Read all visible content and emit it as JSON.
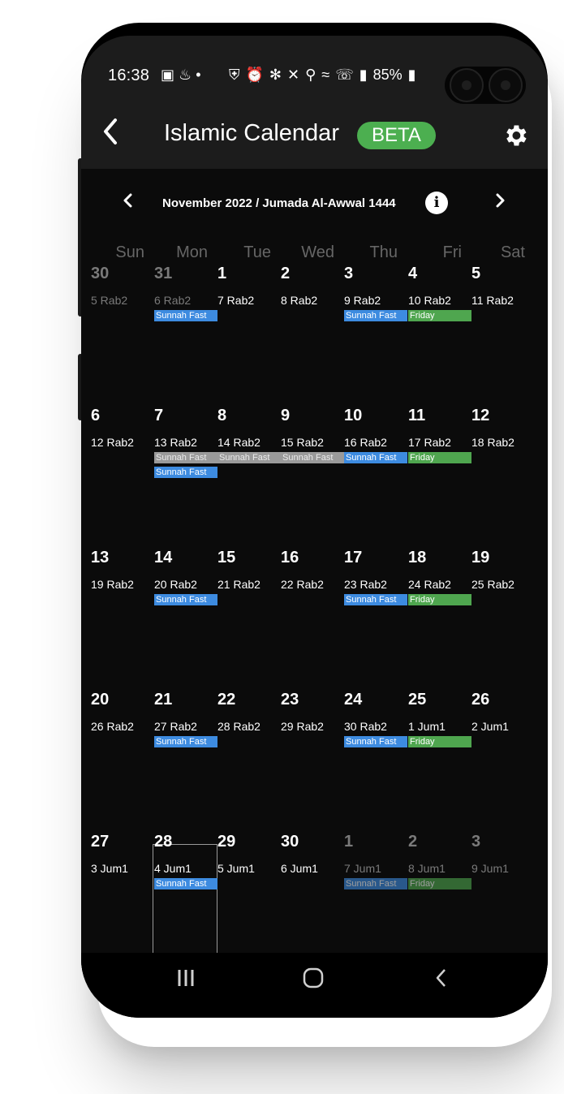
{
  "status_bar": {
    "time": "16:38",
    "battery": "85%",
    "icons": [
      "image-icon",
      "figure-icon",
      "dot-icon",
      "battery-saver-icon",
      "alarm-icon",
      "bluetooth-icon",
      "mute-icon",
      "location-icon",
      "wifi-icon",
      "wifi-call-icon",
      "signal-icon",
      "battery-icon"
    ]
  },
  "app_bar": {
    "back_icon": "chevron-left-icon",
    "title": "Islamic Calendar",
    "badge": "BETA",
    "settings_icon": "gear-icon",
    "badge_color": "#4caf50"
  },
  "month_nav": {
    "label": "November 2022 / Jumada Al-Awwal 1444",
    "prev_icon": "chevron-left-icon",
    "next_icon": "chevron-right-icon",
    "info_icon": "info-icon"
  },
  "weekdays": [
    "Sun",
    "Mon",
    "Tue",
    "Wed",
    "Thu",
    "Fri",
    "Sat"
  ],
  "colors": {
    "sunnah_fast": "#3d8be0",
    "friday": "#4fa64f",
    "background": "#0b0b0b"
  },
  "weeks": [
    [
      {
        "day": "30",
        "hijri": "5 Rab2",
        "dim": true
      },
      {
        "day": "31",
        "hijri": "6 Rab2",
        "dim": true,
        "events": [
          {
            "label": "Sunnah Fast",
            "type": "fast"
          }
        ]
      },
      {
        "day": "1",
        "hijri": "7 Rab2"
      },
      {
        "day": "2",
        "hijri": "8 Rab2"
      },
      {
        "day": "3",
        "hijri": "9 Rab2",
        "events": [
          {
            "label": "Sunnah Fast",
            "type": "fast"
          }
        ]
      },
      {
        "day": "4",
        "hijri": "10 Rab2",
        "events": [
          {
            "label": "Friday",
            "type": "fri"
          }
        ]
      },
      {
        "day": "5",
        "hijri": "11 Rab2"
      }
    ],
    [
      {
        "day": "6",
        "hijri": "12 Rab2"
      },
      {
        "day": "7",
        "hijri": "13 Rab2",
        "events": [
          {
            "label": "Sunnah Fast",
            "type": "grey"
          },
          {
            "label": "Sunnah Fast",
            "type": "fast"
          }
        ]
      },
      {
        "day": "8",
        "hijri": "14 Rab2",
        "events": [
          {
            "label": "Sunnah Fast",
            "type": "grey"
          }
        ]
      },
      {
        "day": "9",
        "hijri": "15 Rab2",
        "events": [
          {
            "label": "Sunnah Fast",
            "type": "grey"
          }
        ]
      },
      {
        "day": "10",
        "hijri": "16 Rab2",
        "events": [
          {
            "label": "Sunnah Fast",
            "type": "fast"
          }
        ]
      },
      {
        "day": "11",
        "hijri": "17 Rab2",
        "events": [
          {
            "label": "Friday",
            "type": "fri"
          }
        ]
      },
      {
        "day": "12",
        "hijri": "18 Rab2"
      }
    ],
    [
      {
        "day": "13",
        "hijri": "19 Rab2"
      },
      {
        "day": "14",
        "hijri": "20 Rab2",
        "events": [
          {
            "label": "Sunnah Fast",
            "type": "fast"
          }
        ]
      },
      {
        "day": "15",
        "hijri": "21 Rab2"
      },
      {
        "day": "16",
        "hijri": "22 Rab2"
      },
      {
        "day": "17",
        "hijri": "23 Rab2",
        "events": [
          {
            "label": "Sunnah Fast",
            "type": "fast"
          }
        ]
      },
      {
        "day": "18",
        "hijri": "24 Rab2",
        "events": [
          {
            "label": "Friday",
            "type": "fri"
          }
        ]
      },
      {
        "day": "19",
        "hijri": "25 Rab2"
      }
    ],
    [
      {
        "day": "20",
        "hijri": "26 Rab2"
      },
      {
        "day": "21",
        "hijri": "27 Rab2",
        "events": [
          {
            "label": "Sunnah Fast",
            "type": "fast"
          }
        ]
      },
      {
        "day": "22",
        "hijri": "28 Rab2"
      },
      {
        "day": "23",
        "hijri": "29 Rab2"
      },
      {
        "day": "24",
        "hijri": "30 Rab2",
        "events": [
          {
            "label": "Sunnah Fast",
            "type": "fast"
          }
        ]
      },
      {
        "day": "25",
        "hijri": "1 Jum1",
        "events": [
          {
            "label": "Friday",
            "type": "fri"
          }
        ]
      },
      {
        "day": "26",
        "hijri": "2 Jum1"
      }
    ],
    [
      {
        "day": "27",
        "hijri": "3 Jum1"
      },
      {
        "day": "28",
        "hijri": "4 Jum1",
        "today": true,
        "events": [
          {
            "label": "Sunnah Fast",
            "type": "fast"
          }
        ]
      },
      {
        "day": "29",
        "hijri": "5 Jum1"
      },
      {
        "day": "30",
        "hijri": "6 Jum1"
      },
      {
        "day": "1",
        "hijri": "7 Jum1",
        "dim": true,
        "events": [
          {
            "label": "Sunnah Fast",
            "type": "fast",
            "faded": true
          }
        ]
      },
      {
        "day": "2",
        "hijri": "8 Jum1",
        "dim": true,
        "events": [
          {
            "label": "Friday",
            "type": "fri",
            "faded": true
          }
        ]
      },
      {
        "day": "3",
        "hijri": "9 Jum1",
        "dim": true
      }
    ]
  ],
  "bottom_nav": {
    "recents_icon": "recents-icon",
    "home_icon": "home-icon",
    "back_icon": "back-icon"
  }
}
